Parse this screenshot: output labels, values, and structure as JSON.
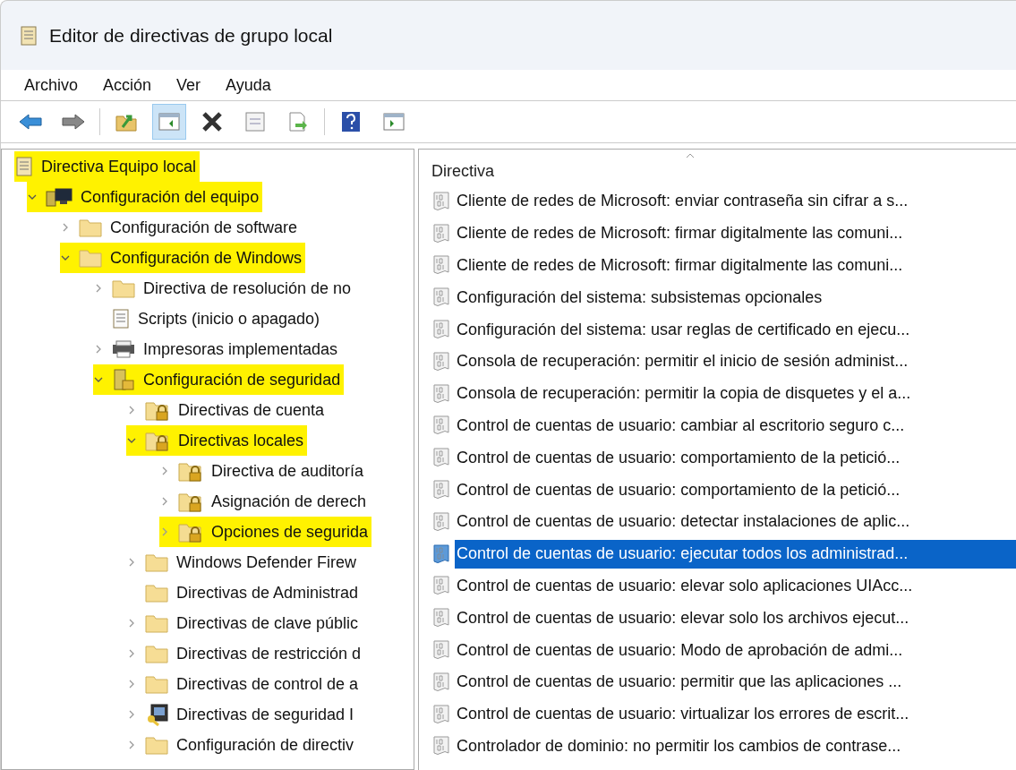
{
  "window": {
    "title": "Editor de directivas de grupo local"
  },
  "menu": [
    "Archivo",
    "Acción",
    "Ver",
    "Ayuda"
  ],
  "toolbar": [
    {
      "kind": "back",
      "pressed": false
    },
    {
      "kind": "forward",
      "pressed": false
    },
    {
      "kind": "sep"
    },
    {
      "kind": "up",
      "pressed": false
    },
    {
      "kind": "tree",
      "pressed": true
    },
    {
      "kind": "delete",
      "pressed": false
    },
    {
      "kind": "properties",
      "pressed": false
    },
    {
      "kind": "export",
      "pressed": false
    },
    {
      "kind": "sep"
    },
    {
      "kind": "help",
      "pressed": false
    },
    {
      "kind": "action",
      "pressed": false
    }
  ],
  "tree": [
    {
      "label": "Directiva Equipo local",
      "kind": "scroll",
      "highlighted": true,
      "children": [
        {
          "label": "Configuración del equipo",
          "kind": "computer",
          "expanded": true,
          "highlighted": true,
          "children": [
            {
              "label": "Configuración de software",
              "kind": "folder",
              "expanded": false,
              "highlighted": false
            },
            {
              "label": "Configuración de Windows",
              "kind": "folder",
              "expanded": true,
              "highlighted": true,
              "children": [
                {
                  "label": "Directiva de resolución de no",
                  "kind": "folder",
                  "expanded": false,
                  "highlighted": false
                },
                {
                  "label": "Scripts (inicio o apagado)",
                  "kind": "script",
                  "highlighted": false
                },
                {
                  "label": "Impresoras implementadas",
                  "kind": "printer",
                  "expanded": false,
                  "highlighted": false
                },
                {
                  "label": "Configuración de seguridad",
                  "kind": "security",
                  "expanded": true,
                  "highlighted": true,
                  "children": [
                    {
                      "label": "Directivas de cuenta",
                      "kind": "lockfolder",
                      "expanded": false,
                      "highlighted": false
                    },
                    {
                      "label": "Directivas locales",
                      "kind": "lockfolder",
                      "expanded": true,
                      "highlighted": true,
                      "children": [
                        {
                          "label": "Directiva de auditoría",
                          "kind": "lockfolder",
                          "expanded": false,
                          "highlighted": false
                        },
                        {
                          "label": "Asignación de derech",
                          "kind": "lockfolder",
                          "expanded": false,
                          "highlighted": false
                        },
                        {
                          "label": "Opciones de segurida",
                          "kind": "lockfolder",
                          "expanded": false,
                          "highlighted": true
                        }
                      ]
                    },
                    {
                      "label": "Windows Defender Firew",
                      "kind": "folder",
                      "expanded": false,
                      "highlighted": false
                    },
                    {
                      "label": "Directivas de Administrad",
                      "kind": "folder",
                      "highlighted": false
                    },
                    {
                      "label": "Directivas de clave públic",
                      "kind": "folder",
                      "expanded": false,
                      "highlighted": false
                    },
                    {
                      "label": "Directivas de restricción d",
                      "kind": "folder",
                      "expanded": false,
                      "highlighted": false
                    },
                    {
                      "label": "Directivas de control de a",
                      "kind": "folder",
                      "expanded": false,
                      "highlighted": false
                    },
                    {
                      "label": "Directivas de seguridad I",
                      "kind": "netkey",
                      "expanded": false,
                      "highlighted": false
                    },
                    {
                      "label": "Configuración de directiv",
                      "kind": "folder",
                      "expanded": false,
                      "highlighted": false
                    }
                  ]
                }
              ]
            }
          ]
        }
      ]
    }
  ],
  "list": {
    "column": "Directiva",
    "items": [
      {
        "text": "Cliente de redes de Microsoft: enviar contraseña sin cifrar a s...",
        "selected": false
      },
      {
        "text": "Cliente de redes de Microsoft: firmar digitalmente las comuni...",
        "selected": false
      },
      {
        "text": "Cliente de redes de Microsoft: firmar digitalmente las comuni...",
        "selected": false
      },
      {
        "text": "Configuración del sistema: subsistemas opcionales",
        "selected": false
      },
      {
        "text": "Configuración del sistema: usar reglas de certificado en ejecu...",
        "selected": false
      },
      {
        "text": "Consola de recuperación: permitir el inicio de sesión administ...",
        "selected": false
      },
      {
        "text": "Consola de recuperación: permitir la copia de disquetes y el a...",
        "selected": false
      },
      {
        "text": "Control de cuentas de usuario: cambiar al escritorio seguro c...",
        "selected": false
      },
      {
        "text": "Control de cuentas de usuario: comportamiento de la petició...",
        "selected": false
      },
      {
        "text": "Control de cuentas de usuario: comportamiento de la petició...",
        "selected": false
      },
      {
        "text": "Control de cuentas de usuario: detectar instalaciones de aplic...",
        "selected": false
      },
      {
        "text": "Control de cuentas de usuario: ejecutar todos los administrad...",
        "selected": true
      },
      {
        "text": "Control de cuentas de usuario: elevar solo aplicaciones UIAcc...",
        "selected": false
      },
      {
        "text": "Control de cuentas de usuario: elevar solo los archivos ejecut...",
        "selected": false
      },
      {
        "text": "Control de cuentas de usuario: Modo de aprobación de admi...",
        "selected": false
      },
      {
        "text": "Control de cuentas de usuario: permitir que las aplicaciones ...",
        "selected": false
      },
      {
        "text": "Control de cuentas de usuario: virtualizar los errores de escrit...",
        "selected": false
      },
      {
        "text": "Controlador de dominio: no permitir los cambios de contrase...",
        "selected": false
      }
    ]
  }
}
